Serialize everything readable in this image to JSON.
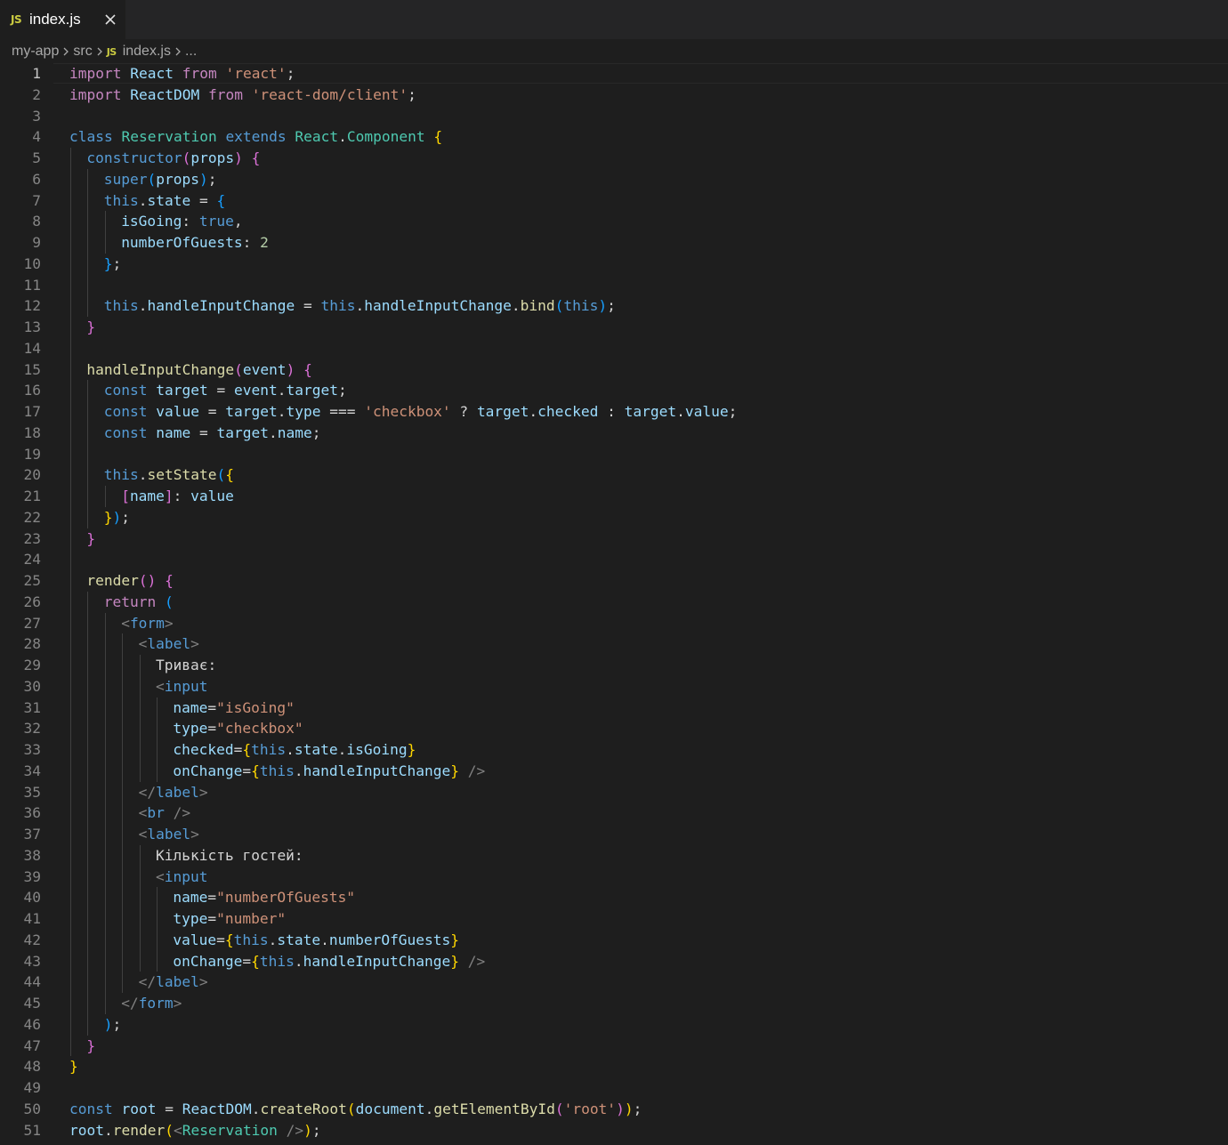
{
  "tab": {
    "icon": "js-file-icon",
    "badge": "JS",
    "label": "index.js",
    "close_icon": "close-icon"
  },
  "breadcrumb": {
    "items": [
      "my-app",
      "src",
      "index.js",
      "..."
    ],
    "file_badge": "JS"
  },
  "colors": {
    "background": "#1e1e1e",
    "tabbar": "#252526",
    "js_badge": "#cbcb41",
    "keyword": "#c586c0",
    "storage": "#569cd6",
    "variable": "#9cdcfe",
    "class": "#4ec9b0",
    "string": "#ce9178",
    "number": "#b5cea8",
    "function": "#dcdcaa"
  },
  "editor": {
    "current_line": 1,
    "lines": [
      {
        "n": "1",
        "indent": 0,
        "tokens": [
          [
            "kw",
            "import"
          ],
          [
            "p",
            " "
          ],
          [
            "var",
            "React"
          ],
          [
            "p",
            " "
          ],
          [
            "kw",
            "from"
          ],
          [
            "p",
            " "
          ],
          [
            "str",
            "'react'"
          ],
          [
            "p",
            ";"
          ]
        ]
      },
      {
        "n": "2",
        "indent": 0,
        "tokens": [
          [
            "kw",
            "import"
          ],
          [
            "p",
            " "
          ],
          [
            "var",
            "ReactDOM"
          ],
          [
            "p",
            " "
          ],
          [
            "kw",
            "from"
          ],
          [
            "p",
            " "
          ],
          [
            "str",
            "'react-dom/client'"
          ],
          [
            "p",
            ";"
          ]
        ]
      },
      {
        "n": "3",
        "indent": 0,
        "tokens": []
      },
      {
        "n": "4",
        "indent": 0,
        "tokens": [
          [
            "st",
            "class"
          ],
          [
            "p",
            " "
          ],
          [
            "cls",
            "Reservation"
          ],
          [
            "p",
            " "
          ],
          [
            "st",
            "extends"
          ],
          [
            "p",
            " "
          ],
          [
            "cls",
            "React"
          ],
          [
            "p",
            "."
          ],
          [
            "cls",
            "Component"
          ],
          [
            "p",
            " "
          ],
          [
            "b1",
            "{"
          ]
        ]
      },
      {
        "n": "5",
        "indent": 1,
        "tokens": [
          [
            "st",
            "constructor"
          ],
          [
            "b2",
            "("
          ],
          [
            "var",
            "props"
          ],
          [
            "b2",
            ")"
          ],
          [
            "p",
            " "
          ],
          [
            "b2",
            "{"
          ]
        ]
      },
      {
        "n": "6",
        "indent": 2,
        "tokens": [
          [
            "st",
            "super"
          ],
          [
            "b3",
            "("
          ],
          [
            "var",
            "props"
          ],
          [
            "b3",
            ")"
          ],
          [
            "p",
            ";"
          ]
        ]
      },
      {
        "n": "7",
        "indent": 2,
        "tokens": [
          [
            "st",
            "this"
          ],
          [
            "p",
            "."
          ],
          [
            "var",
            "state"
          ],
          [
            "p",
            " = "
          ],
          [
            "b3",
            "{"
          ]
        ]
      },
      {
        "n": "8",
        "indent": 3,
        "tokens": [
          [
            "var",
            "isGoing"
          ],
          [
            "p",
            ": "
          ],
          [
            "st",
            "true"
          ],
          [
            "p",
            ","
          ]
        ]
      },
      {
        "n": "9",
        "indent": 3,
        "tokens": [
          [
            "var",
            "numberOfGuests"
          ],
          [
            "p",
            ": "
          ],
          [
            "num",
            "2"
          ]
        ]
      },
      {
        "n": "10",
        "indent": 2,
        "tokens": [
          [
            "b3",
            "}"
          ],
          [
            "p",
            ";"
          ]
        ]
      },
      {
        "n": "11",
        "indent": 2,
        "tokens": []
      },
      {
        "n": "12",
        "indent": 2,
        "tokens": [
          [
            "st",
            "this"
          ],
          [
            "p",
            "."
          ],
          [
            "var",
            "handleInputChange"
          ],
          [
            "p",
            " = "
          ],
          [
            "st",
            "this"
          ],
          [
            "p",
            "."
          ],
          [
            "var",
            "handleInputChange"
          ],
          [
            "p",
            "."
          ],
          [
            "fn",
            "bind"
          ],
          [
            "b3",
            "("
          ],
          [
            "st",
            "this"
          ],
          [
            "b3",
            ")"
          ],
          [
            "p",
            ";"
          ]
        ]
      },
      {
        "n": "13",
        "indent": 1,
        "tokens": [
          [
            "b2",
            "}"
          ]
        ]
      },
      {
        "n": "14",
        "indent": 1,
        "tokens": []
      },
      {
        "n": "15",
        "indent": 1,
        "tokens": [
          [
            "fn",
            "handleInputChange"
          ],
          [
            "b2",
            "("
          ],
          [
            "var",
            "event"
          ],
          [
            "b2",
            ")"
          ],
          [
            "p",
            " "
          ],
          [
            "b2",
            "{"
          ]
        ]
      },
      {
        "n": "16",
        "indent": 2,
        "tokens": [
          [
            "st",
            "const"
          ],
          [
            "p",
            " "
          ],
          [
            "var",
            "target"
          ],
          [
            "p",
            " = "
          ],
          [
            "var",
            "event"
          ],
          [
            "p",
            "."
          ],
          [
            "var",
            "target"
          ],
          [
            "p",
            ";"
          ]
        ]
      },
      {
        "n": "17",
        "indent": 2,
        "tokens": [
          [
            "st",
            "const"
          ],
          [
            "p",
            " "
          ],
          [
            "var",
            "value"
          ],
          [
            "p",
            " = "
          ],
          [
            "var",
            "target"
          ],
          [
            "p",
            "."
          ],
          [
            "var",
            "type"
          ],
          [
            "p",
            " === "
          ],
          [
            "str",
            "'checkbox'"
          ],
          [
            "p",
            " ? "
          ],
          [
            "var",
            "target"
          ],
          [
            "p",
            "."
          ],
          [
            "var",
            "checked"
          ],
          [
            "p",
            " : "
          ],
          [
            "var",
            "target"
          ],
          [
            "p",
            "."
          ],
          [
            "var",
            "value"
          ],
          [
            "p",
            ";"
          ]
        ]
      },
      {
        "n": "18",
        "indent": 2,
        "tokens": [
          [
            "st",
            "const"
          ],
          [
            "p",
            " "
          ],
          [
            "var",
            "name"
          ],
          [
            "p",
            " = "
          ],
          [
            "var",
            "target"
          ],
          [
            "p",
            "."
          ],
          [
            "var",
            "name"
          ],
          [
            "p",
            ";"
          ]
        ]
      },
      {
        "n": "19",
        "indent": 2,
        "tokens": []
      },
      {
        "n": "20",
        "indent": 2,
        "tokens": [
          [
            "st",
            "this"
          ],
          [
            "p",
            "."
          ],
          [
            "fn",
            "setState"
          ],
          [
            "b3",
            "("
          ],
          [
            "b1",
            "{"
          ]
        ]
      },
      {
        "n": "21",
        "indent": 3,
        "tokens": [
          [
            "b2",
            "["
          ],
          [
            "var",
            "name"
          ],
          [
            "b2",
            "]"
          ],
          [
            "p",
            ": "
          ],
          [
            "var",
            "value"
          ]
        ]
      },
      {
        "n": "22",
        "indent": 2,
        "tokens": [
          [
            "b1",
            "}"
          ],
          [
            "b3",
            ")"
          ],
          [
            "p",
            ";"
          ]
        ]
      },
      {
        "n": "23",
        "indent": 1,
        "tokens": [
          [
            "b2",
            "}"
          ]
        ]
      },
      {
        "n": "24",
        "indent": 1,
        "tokens": []
      },
      {
        "n": "25",
        "indent": 1,
        "tokens": [
          [
            "fn",
            "render"
          ],
          [
            "b2",
            "()"
          ],
          [
            "p",
            " "
          ],
          [
            "b2",
            "{"
          ]
        ]
      },
      {
        "n": "26",
        "indent": 2,
        "tokens": [
          [
            "kw",
            "return"
          ],
          [
            "p",
            " "
          ],
          [
            "b3",
            "("
          ]
        ]
      },
      {
        "n": "27",
        "indent": 3,
        "tokens": [
          [
            "ang",
            "<"
          ],
          [
            "tag",
            "form"
          ],
          [
            "ang",
            ">"
          ]
        ]
      },
      {
        "n": "28",
        "indent": 4,
        "tokens": [
          [
            "ang",
            "<"
          ],
          [
            "tag",
            "label"
          ],
          [
            "ang",
            ">"
          ]
        ]
      },
      {
        "n": "29",
        "indent": 5,
        "tokens": [
          [
            "txt",
            "Триває:"
          ]
        ]
      },
      {
        "n": "30",
        "indent": 5,
        "tokens": [
          [
            "ang",
            "<"
          ],
          [
            "tag",
            "input"
          ]
        ]
      },
      {
        "n": "31",
        "indent": 6,
        "tokens": [
          [
            "var",
            "name"
          ],
          [
            "p",
            "="
          ],
          [
            "str",
            "\"isGoing\""
          ]
        ]
      },
      {
        "n": "32",
        "indent": 6,
        "tokens": [
          [
            "var",
            "type"
          ],
          [
            "p",
            "="
          ],
          [
            "str",
            "\"checkbox\""
          ]
        ]
      },
      {
        "n": "33",
        "indent": 6,
        "tokens": [
          [
            "var",
            "checked"
          ],
          [
            "p",
            "="
          ],
          [
            "b1",
            "{"
          ],
          [
            "st",
            "this"
          ],
          [
            "p",
            "."
          ],
          [
            "var",
            "state"
          ],
          [
            "p",
            "."
          ],
          [
            "var",
            "isGoing"
          ],
          [
            "b1",
            "}"
          ]
        ]
      },
      {
        "n": "34",
        "indent": 6,
        "tokens": [
          [
            "var",
            "onChange"
          ],
          [
            "p",
            "="
          ],
          [
            "b1",
            "{"
          ],
          [
            "st",
            "this"
          ],
          [
            "p",
            "."
          ],
          [
            "var",
            "handleInputChange"
          ],
          [
            "b1",
            "}"
          ],
          [
            "p",
            " "
          ],
          [
            "ang",
            "/>"
          ]
        ]
      },
      {
        "n": "35",
        "indent": 4,
        "tokens": [
          [
            "ang",
            "</"
          ],
          [
            "tag",
            "label"
          ],
          [
            "ang",
            ">"
          ]
        ]
      },
      {
        "n": "36",
        "indent": 4,
        "tokens": [
          [
            "ang",
            "<"
          ],
          [
            "tag",
            "br"
          ],
          [
            "p",
            " "
          ],
          [
            "ang",
            "/>"
          ]
        ]
      },
      {
        "n": "37",
        "indent": 4,
        "tokens": [
          [
            "ang",
            "<"
          ],
          [
            "tag",
            "label"
          ],
          [
            "ang",
            ">"
          ]
        ]
      },
      {
        "n": "38",
        "indent": 5,
        "tokens": [
          [
            "txt",
            "Кількість гостей:"
          ]
        ]
      },
      {
        "n": "39",
        "indent": 5,
        "tokens": [
          [
            "ang",
            "<"
          ],
          [
            "tag",
            "input"
          ]
        ]
      },
      {
        "n": "40",
        "indent": 6,
        "tokens": [
          [
            "var",
            "name"
          ],
          [
            "p",
            "="
          ],
          [
            "str",
            "\"numberOfGuests\""
          ]
        ]
      },
      {
        "n": "41",
        "indent": 6,
        "tokens": [
          [
            "var",
            "type"
          ],
          [
            "p",
            "="
          ],
          [
            "str",
            "\"number\""
          ]
        ]
      },
      {
        "n": "42",
        "indent": 6,
        "tokens": [
          [
            "var",
            "value"
          ],
          [
            "p",
            "="
          ],
          [
            "b1",
            "{"
          ],
          [
            "st",
            "this"
          ],
          [
            "p",
            "."
          ],
          [
            "var",
            "state"
          ],
          [
            "p",
            "."
          ],
          [
            "var",
            "numberOfGuests"
          ],
          [
            "b1",
            "}"
          ]
        ]
      },
      {
        "n": "43",
        "indent": 6,
        "tokens": [
          [
            "var",
            "onChange"
          ],
          [
            "p",
            "="
          ],
          [
            "b1",
            "{"
          ],
          [
            "st",
            "this"
          ],
          [
            "p",
            "."
          ],
          [
            "var",
            "handleInputChange"
          ],
          [
            "b1",
            "}"
          ],
          [
            "p",
            " "
          ],
          [
            "ang",
            "/>"
          ]
        ]
      },
      {
        "n": "44",
        "indent": 4,
        "tokens": [
          [
            "ang",
            "</"
          ],
          [
            "tag",
            "label"
          ],
          [
            "ang",
            ">"
          ]
        ]
      },
      {
        "n": "45",
        "indent": 3,
        "tokens": [
          [
            "ang",
            "</"
          ],
          [
            "tag",
            "form"
          ],
          [
            "ang",
            ">"
          ]
        ]
      },
      {
        "n": "46",
        "indent": 2,
        "tokens": [
          [
            "b3",
            ")"
          ],
          [
            "p",
            ";"
          ]
        ]
      },
      {
        "n": "47",
        "indent": 1,
        "tokens": [
          [
            "b2",
            "}"
          ]
        ]
      },
      {
        "n": "48",
        "indent": 0,
        "tokens": [
          [
            "b1",
            "}"
          ]
        ]
      },
      {
        "n": "49",
        "indent": 0,
        "tokens": []
      },
      {
        "n": "50",
        "indent": 0,
        "tokens": [
          [
            "st",
            "const"
          ],
          [
            "p",
            " "
          ],
          [
            "var",
            "root"
          ],
          [
            "p",
            " = "
          ],
          [
            "var",
            "ReactDOM"
          ],
          [
            "p",
            "."
          ],
          [
            "fn",
            "createRoot"
          ],
          [
            "b1",
            "("
          ],
          [
            "var",
            "document"
          ],
          [
            "p",
            "."
          ],
          [
            "fn",
            "getElementById"
          ],
          [
            "b2",
            "("
          ],
          [
            "str",
            "'root'"
          ],
          [
            "b2",
            ")"
          ],
          [
            "b1",
            ")"
          ],
          [
            "p",
            ";"
          ]
        ]
      },
      {
        "n": "51",
        "indent": 0,
        "tokens": [
          [
            "var",
            "root"
          ],
          [
            "p",
            "."
          ],
          [
            "fn",
            "render"
          ],
          [
            "b1",
            "("
          ],
          [
            "ang",
            "<"
          ],
          [
            "cls",
            "Reservation"
          ],
          [
            "p",
            " "
          ],
          [
            "ang",
            "/>"
          ],
          [
            "b1",
            ")"
          ],
          [
            "p",
            ";"
          ]
        ]
      }
    ]
  }
}
